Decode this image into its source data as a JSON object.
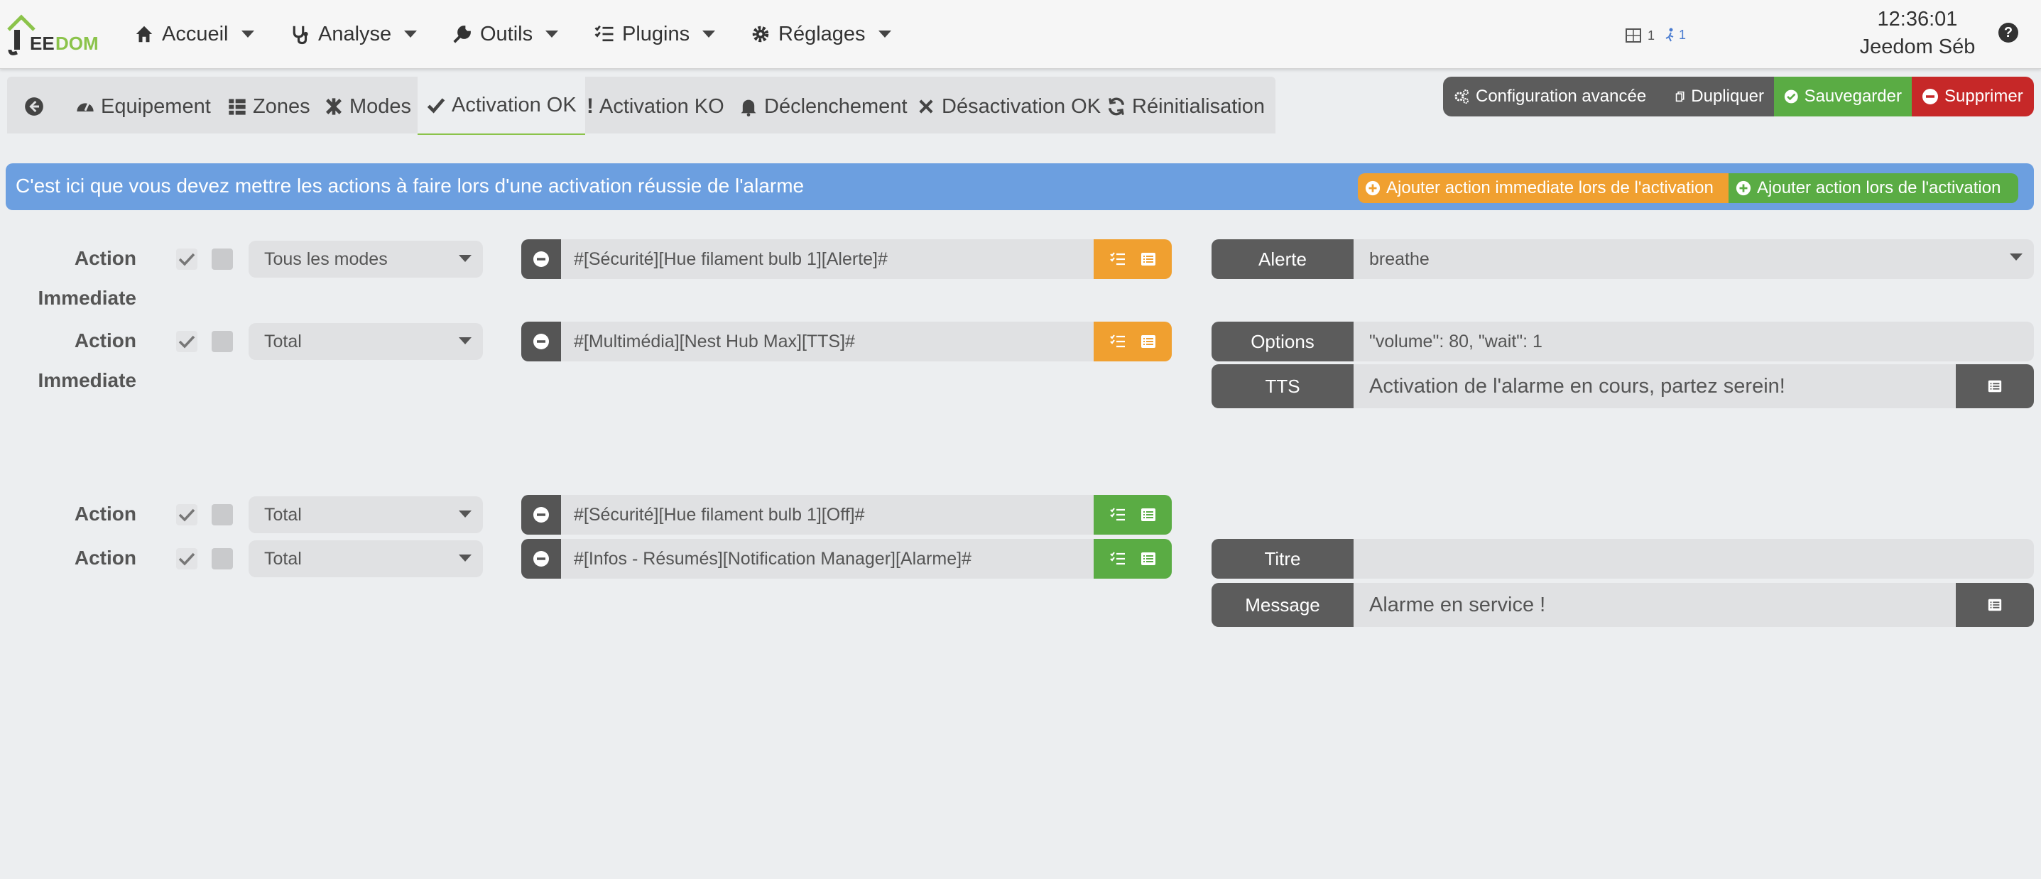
{
  "app": {
    "logo_text": "JEEDOM"
  },
  "nav": {
    "accueil": "Accueil",
    "analyse": "Analyse",
    "outils": "Outils",
    "plugins": "Plugins",
    "reglages": "Réglages",
    "badge1": "1",
    "badge2": "1",
    "time": "12:36:01",
    "user": "Jeedom Séb"
  },
  "tabs": {
    "equipement": "Equipement",
    "zones": "Zones",
    "modes": "Modes",
    "activation_ok": "Activation OK",
    "activation_ko": "Activation KO",
    "declenchement": "Déclenchement",
    "desactivation_ok": "Désactivation OK",
    "reinitialisation": "Réinitialisation"
  },
  "toolbar": {
    "config": "Configuration avancée",
    "dupliquer": "Dupliquer",
    "sauvegarder": "Sauvegarder",
    "supprimer": "Supprimer"
  },
  "banner": {
    "text": "C'est ici que vous devez mettre les actions à faire lors d'une activation réussie de l'alarme",
    "add_immediate": "Ajouter action immediate lors de l'activation",
    "add_action": "Ajouter action lors de l'activation"
  },
  "rows": [
    {
      "label": "Action",
      "label2": "Immediate",
      "mode": "Tous les modes",
      "cmd": "#[Sécurité][Hue filament bulb 1][Alerte]#",
      "opt_label": "Alerte",
      "opt_value": "breathe"
    },
    {
      "label": "Action",
      "label2": "Immediate",
      "mode": "Total",
      "cmd": "#[Multimédia][Nest Hub Max][TTS]#",
      "opt_label": "Options",
      "opt_value": "\"volume\": 80, \"wait\": 1",
      "opt2_label": "TTS",
      "opt2_value": "Activation de l'alarme en cours, partez serein!"
    },
    {
      "label": "Action",
      "mode": "Total",
      "cmd": "#[Sécurité][Hue filament bulb 1][Off]#"
    },
    {
      "label": "Action",
      "mode": "Total",
      "cmd": "#[Infos - Résumés][Notification Manager][Alarme]#",
      "opt_label": "Titre",
      "opt_value": "",
      "opt2_label": "Message",
      "opt2_value": "Alarme en service !"
    }
  ],
  "colors": {
    "orange": "#f0a030",
    "green": "#5aac44",
    "red": "#c62828",
    "dark": "#5c5c5c",
    "blue": "#6c9fe0"
  }
}
